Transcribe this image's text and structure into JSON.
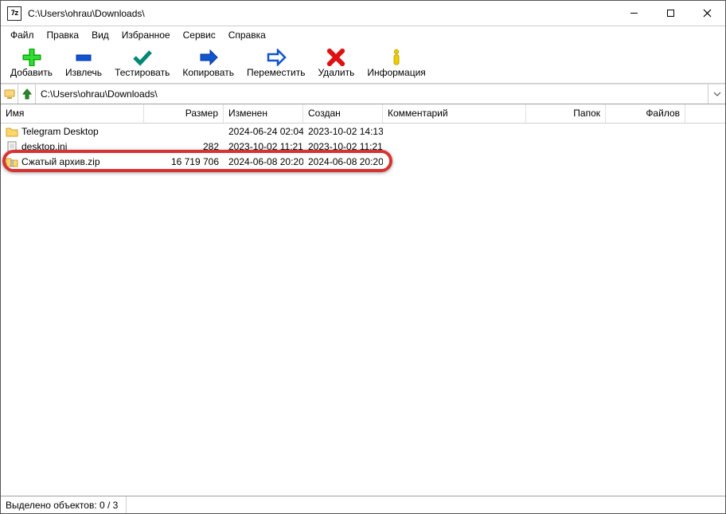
{
  "title": "C:\\Users\\ohrau\\Downloads\\",
  "menu": [
    "Файл",
    "Правка",
    "Вид",
    "Избранное",
    "Сервис",
    "Справка"
  ],
  "toolbar": [
    {
      "id": "add",
      "label": "Добавить"
    },
    {
      "id": "extract",
      "label": "Извлечь"
    },
    {
      "id": "test",
      "label": "Тестировать"
    },
    {
      "id": "copy",
      "label": "Копировать"
    },
    {
      "id": "move",
      "label": "Переместить"
    },
    {
      "id": "delete",
      "label": "Удалить"
    },
    {
      "id": "info",
      "label": "Информация"
    }
  ],
  "address": "C:\\Users\\ohrau\\Downloads\\",
  "columns": [
    "Имя",
    "Размер",
    "Изменен",
    "Создан",
    "Комментарий",
    "Папок",
    "Файлов"
  ],
  "rows": [
    {
      "icon": "folder",
      "name": "Telegram Desktop",
      "size": "",
      "mod": "2024-06-24 02:04",
      "cre": "2023-10-02 14:13",
      "com": "",
      "fold": "",
      "files": ""
    },
    {
      "icon": "ini",
      "name": "desktop.ini",
      "size": "282",
      "mod": "2023-10-02 11:21",
      "cre": "2023-10-02 11:21",
      "com": "",
      "fold": "",
      "files": ""
    },
    {
      "icon": "zip",
      "name": "Сжатый архив.zip",
      "size": "16 719 706",
      "mod": "2024-06-08 20:20",
      "cre": "2024-06-08 20:20",
      "com": "",
      "fold": "",
      "files": ""
    }
  ],
  "status": "Выделено объектов: 0 / 3"
}
